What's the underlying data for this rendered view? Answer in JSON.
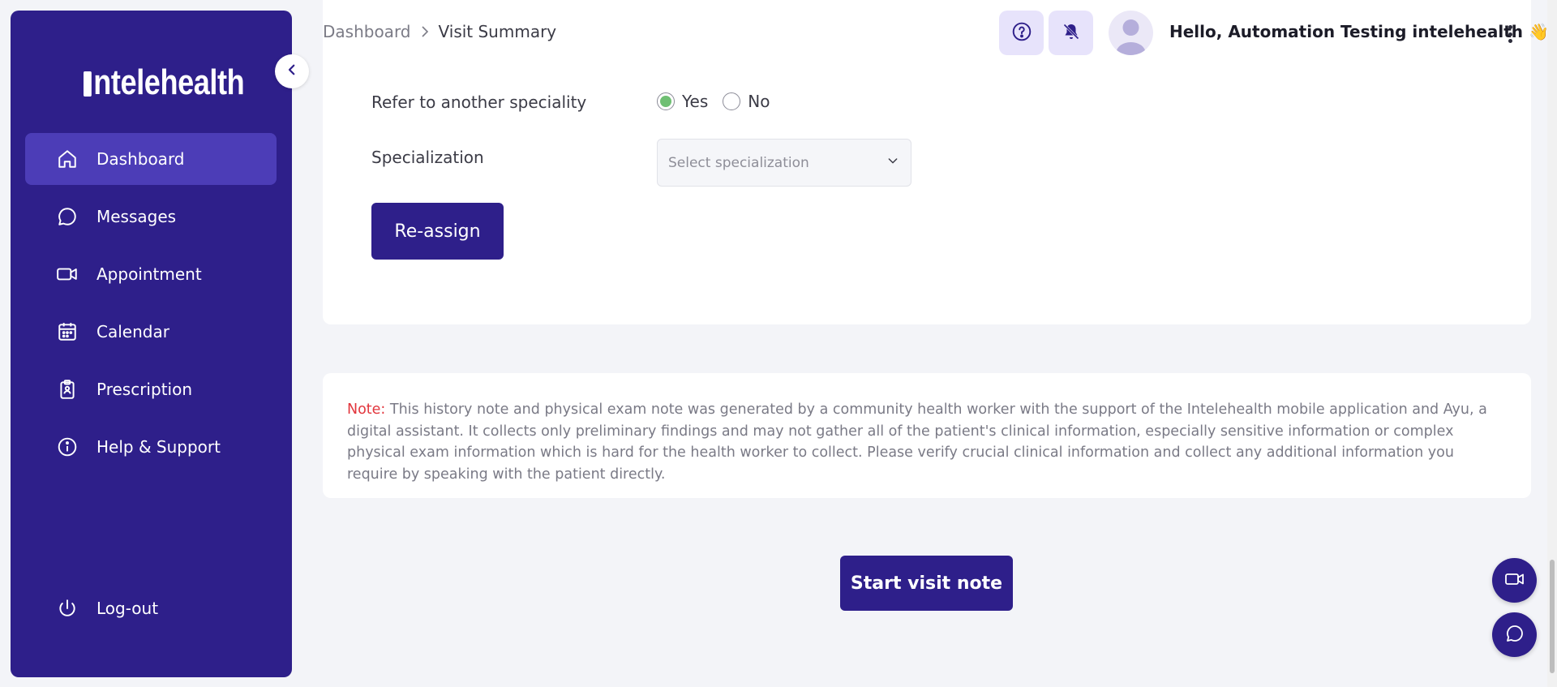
{
  "brand": {
    "logo_text": "ntelehealth",
    "primary_color": "#2e1f8a",
    "accent_active": "#4c3db7"
  },
  "sidebar": {
    "items": [
      {
        "label": "Dashboard",
        "icon": "home-icon",
        "active": true
      },
      {
        "label": "Messages",
        "icon": "chat-icon"
      },
      {
        "label": "Appointment",
        "icon": "video-icon"
      },
      {
        "label": "Calendar",
        "icon": "calendar-icon"
      },
      {
        "label": "Prescription",
        "icon": "clipboard-icon"
      },
      {
        "label": "Help & Support",
        "icon": "info-icon"
      }
    ],
    "logout_label": "Log-out"
  },
  "header": {
    "breadcrumb": [
      "Dashboard",
      "Visit Summary"
    ],
    "greeting": "Hello, Automation Testing intelehealth 👋"
  },
  "referral": {
    "refer_label": "Refer to another speciality",
    "options": [
      "Yes",
      "No"
    ],
    "selected": "Yes",
    "specialization_label": "Specialization",
    "specialization_placeholder": "Select specialization",
    "reassign_label": "Re-assign"
  },
  "note": {
    "label": "Note:",
    "text": " This history note and physical exam note was generated by a community health worker with the support of the Intelehealth mobile application and Ayu, a digital assistant. It collects only preliminary findings and may not gather all of the patient's clinical information, especially sensitive information or complex physical exam information which is hard for the health worker to collect. Please verify crucial clinical information and collect any additional information you require by speaking with the patient directly."
  },
  "actions": {
    "start_visit_note": "Start visit note"
  }
}
